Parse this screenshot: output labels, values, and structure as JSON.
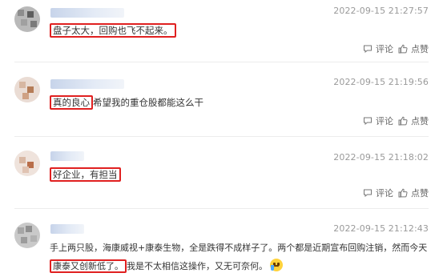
{
  "comments": [
    {
      "timestamp": "2022-09-15 21:27:57",
      "text_highlight": "盘子太大，回购也飞不起来。",
      "text_rest": "",
      "text_line2_highlight": "",
      "text_line2_rest": "",
      "reply_label": "评论",
      "like_label": "点赞"
    },
    {
      "timestamp": "2022-09-15 21:19:56",
      "text_highlight": "真的良心",
      "text_rest": "希望我的重仓股都能这么干",
      "reply_label": "评论",
      "like_label": "点赞"
    },
    {
      "timestamp": "2022-09-15 21:18:02",
      "text_highlight": "好企业，有担当",
      "text_rest": "",
      "reply_label": "评论",
      "like_label": "点赞"
    },
    {
      "timestamp": "2022-09-15 21:12:43",
      "text_line1": "手上两只股，海康威视+康泰生物，全是跌得不成样子了。两个都是近期宣布回购注销，然而今天",
      "text_line2_highlight": "康泰又创新低了。",
      "text_line2_rest": "我是不太相信这操作，又无可奈何。",
      "emoji_name": "crying-face-icon"
    }
  ],
  "colors": {
    "highlight_border": "#e02020",
    "timestamp": "#9a9a9a",
    "text": "#333333",
    "divider": "#ececec"
  }
}
